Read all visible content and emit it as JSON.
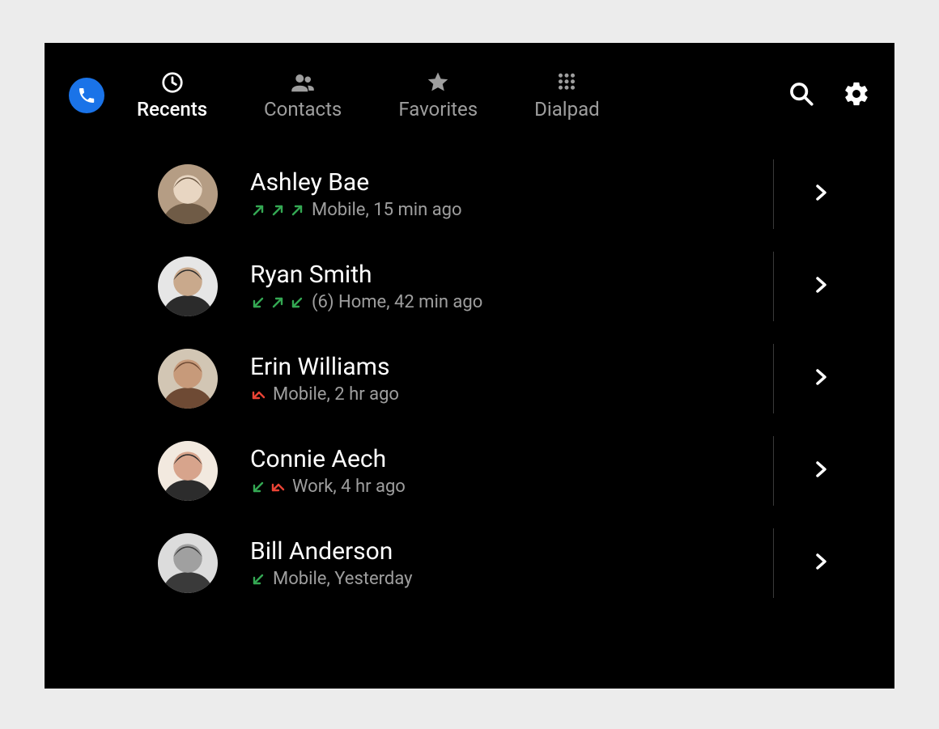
{
  "tabs": {
    "recents": {
      "label": "Recents"
    },
    "contacts": {
      "label": "Contacts"
    },
    "favorites": {
      "label": "Favorites"
    },
    "dialpad": {
      "label": "Dialpad"
    }
  },
  "activeTab": "recents",
  "calls": [
    {
      "name": "Ashley Bae",
      "count": "",
      "line": "Mobile",
      "time": "15 min ago",
      "arrows": [
        {
          "type": "outgoing",
          "color": "green"
        },
        {
          "type": "outgoing",
          "color": "green"
        },
        {
          "type": "outgoing",
          "color": "green"
        }
      ],
      "avatarPalette": [
        "#b59d84",
        "#e8d6c2",
        "#6f5b46"
      ]
    },
    {
      "name": "Ryan Smith",
      "count": "(6)",
      "line": "Home",
      "time": "42 min ago",
      "arrows": [
        {
          "type": "incoming",
          "color": "green"
        },
        {
          "type": "outgoing",
          "color": "green"
        },
        {
          "type": "incoming",
          "color": "green"
        }
      ],
      "avatarPalette": [
        "#e6e6e6",
        "#c9a98c",
        "#2b2b2b"
      ]
    },
    {
      "name": "Erin Williams",
      "count": "",
      "line": "Mobile",
      "time": "2 hr ago",
      "arrows": [
        {
          "type": "missed",
          "color": "red"
        }
      ],
      "avatarPalette": [
        "#d2c6b4",
        "#c79a7a",
        "#6e4a34"
      ]
    },
    {
      "name": "Connie Aech",
      "count": "",
      "line": "Work",
      "time": "4 hr ago",
      "arrows": [
        {
          "type": "incoming",
          "color": "green"
        },
        {
          "type": "missed",
          "color": "red"
        }
      ],
      "avatarPalette": [
        "#f2e9df",
        "#d7a48c",
        "#2c2c2c"
      ]
    },
    {
      "name": "Bill Anderson",
      "count": "",
      "line": "Mobile",
      "time": "Yesterday",
      "arrows": [
        {
          "type": "incoming",
          "color": "green"
        }
      ],
      "avatarPalette": [
        "#dcdcdc",
        "#a0a0a0",
        "#3a3a3a"
      ]
    }
  ]
}
